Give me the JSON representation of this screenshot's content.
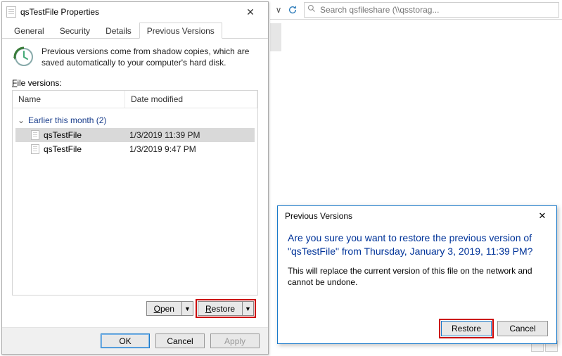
{
  "explorer": {
    "search_placeholder": "Search qsfileshare (\\\\qsstorag..."
  },
  "props": {
    "window_title": "qsTestFile Properties",
    "tabs": [
      "General",
      "Security",
      "Details",
      "Previous Versions"
    ],
    "active_tab": 3,
    "intro": "Previous versions come from shadow copies, which are saved automatically to your computer's hard disk.",
    "file_versions_label": "File versions:",
    "columns": {
      "name": "Name",
      "date": "Date modified"
    },
    "group_label": "Earlier this month (2)",
    "rows": [
      {
        "name": "qsTestFile",
        "date": "1/3/2019 11:39 PM",
        "selected": true
      },
      {
        "name": "qsTestFile",
        "date": "1/3/2019 9:47 PM",
        "selected": false
      }
    ],
    "open_label": "Open",
    "restore_label": "Restore",
    "ok_label": "OK",
    "cancel_label": "Cancel",
    "apply_label": "Apply"
  },
  "confirm": {
    "title": "Previous Versions",
    "question": "Are you sure you want to restore the previous version of \"qsTestFile\" from Thursday, January 3, 2019, 11:39 PM?",
    "warning": "This will replace the current version of this file on the network and cannot be undone.",
    "restore_label": "Restore",
    "cancel_label": "Cancel"
  }
}
